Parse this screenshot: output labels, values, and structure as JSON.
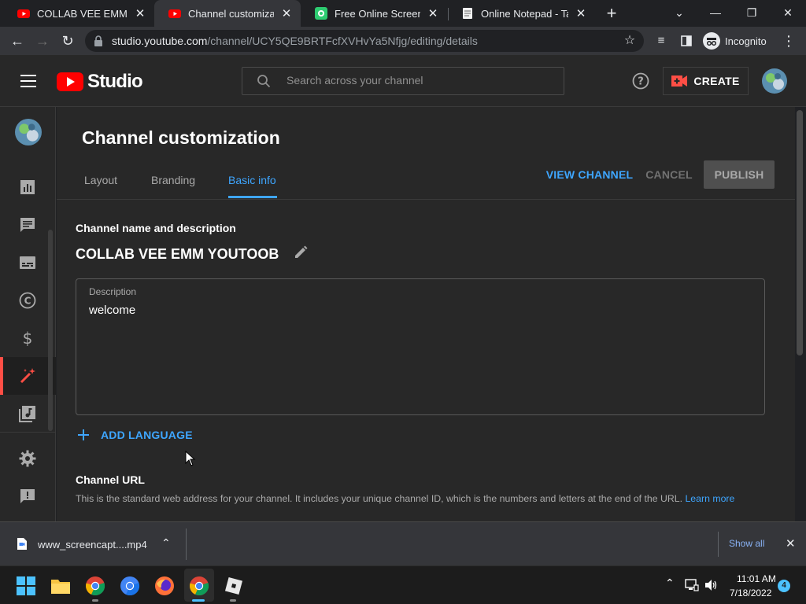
{
  "browser": {
    "tabs": [
      {
        "title": "COLLAB VEE EMM YOUTOOB",
        "active": false
      },
      {
        "title": "Channel customization - YouTube Studio",
        "active": true
      },
      {
        "title": "Free Online Screen Recorder",
        "active": false
      },
      {
        "title": "Online Notepad - Take Notes",
        "active": false
      }
    ],
    "url_host": "studio.youtube.com",
    "url_path": "/channel/UCY5QE9BRTFcfXVHvYa5Nfjg/editing/details",
    "incognito_label": "Incognito"
  },
  "studio": {
    "logo_text": "Studio",
    "search_placeholder": "Search across your channel",
    "create_label": "CREATE"
  },
  "page": {
    "title": "Channel customization",
    "tabs": [
      {
        "label": "Layout",
        "active": false
      },
      {
        "label": "Branding",
        "active": false
      },
      {
        "label": "Basic info",
        "active": true
      }
    ],
    "actions": {
      "view_channel": "VIEW CHANNEL",
      "cancel": "CANCEL",
      "publish": "PUBLISH"
    },
    "section_title": "Channel name and description",
    "channel_name": "COLLAB VEE EMM YOUTOOB",
    "description_label": "Description",
    "description_value": "welcome",
    "add_language": "ADD LANGUAGE",
    "url_section_title": "Channel URL",
    "url_section_text": "This is the standard web address for your channel. It includes your unique channel ID, which is the numbers and letters at the end of the URL.",
    "learn_more": "Learn more"
  },
  "download_bar": {
    "file_name": "www_screencapt....mp4",
    "show_all": "Show all"
  },
  "taskbar": {
    "time": "11:01 AM",
    "date": "7/18/2022",
    "notification_count": "4"
  },
  "colors": {
    "accent_blue": "#3ea6ff",
    "youtube_red": "#ff0000",
    "background": "#282828"
  }
}
